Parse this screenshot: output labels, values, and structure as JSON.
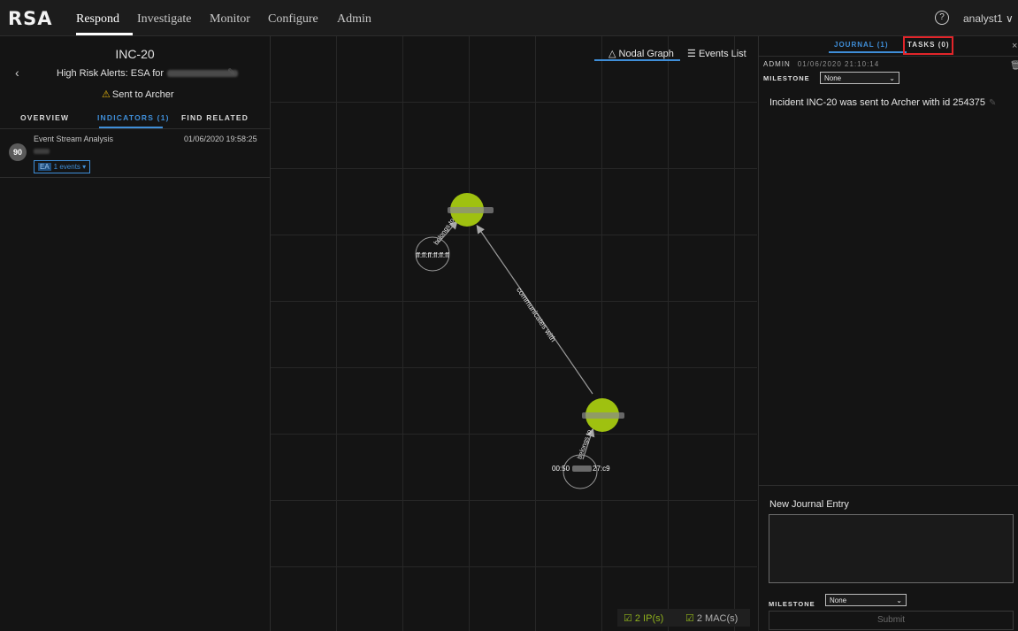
{
  "nav": {
    "logo": "RSA",
    "items": [
      "Respond",
      "Investigate",
      "Monitor",
      "Configure",
      "Admin"
    ],
    "help_icon": "?",
    "user": "analyst1 ∨"
  },
  "incident": {
    "id": "INC-20",
    "title": "High Risk Alerts: ESA for",
    "status": "Sent to Archer",
    "tabs": [
      "OVERVIEW",
      "INDICATORS (1)",
      "FIND RELATED"
    ],
    "indicator": {
      "name": "Event Stream Analysis",
      "date": "01/06/2020 19:58:25",
      "risk_score": "90",
      "events_tag": "EA",
      "events_label": "1 events ▾"
    }
  },
  "graph": {
    "toggle_nodal": "Nodal Graph",
    "toggle_events": "Events List",
    "nodal_icon": "nodal-graph-icon",
    "list_icon": "events-list-icon",
    "edges": {
      "communicates": "communicates with",
      "belongs1": "belongs to",
      "belongs2": "belongs to"
    },
    "node_labels": {
      "mac1": "ff:ff:ff:ff:ff:ff",
      "mac2_prefix": "00:50",
      "mac2_suffix": "27:c9"
    },
    "legend": {
      "ips": "2 IP(s)",
      "macs": "2 MAC(s)"
    },
    "colors": {
      "ip_node": "#9fc110",
      "link": "#9a9a9a"
    }
  },
  "journal": {
    "tab_journal": "JOURNAL (1)",
    "tab_tasks": "TASKS (0)",
    "close": "×",
    "author": "ADMIN",
    "timestamp": "01/06/2020 21:10:14",
    "milestone_label": "MILESTONE",
    "milestone_value": "None",
    "note": "Incident INC-20 was sent to Archer with id 254375",
    "new_entry_label": "New Journal Entry",
    "new_milestone_label": "MILESTONE",
    "new_milestone_value": "None",
    "submit": "Submit"
  }
}
